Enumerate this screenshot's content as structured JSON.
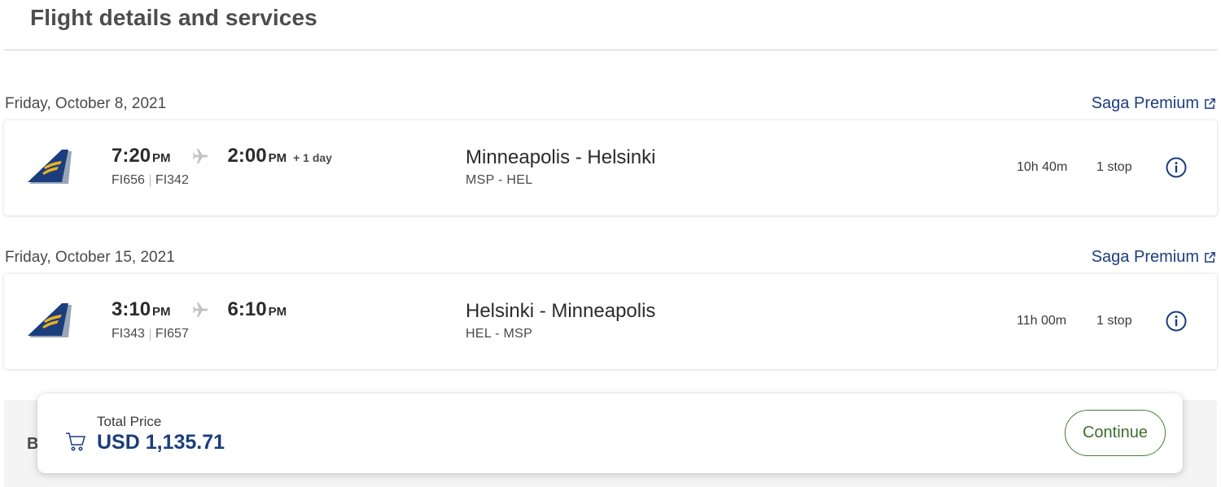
{
  "page": {
    "title": "Flight details and services"
  },
  "colors": {
    "brand_navy": "#1b3d7d",
    "continue_green": "#3f6e2b",
    "logo_gold": "#e9b123"
  },
  "flights": [
    {
      "date": "Friday, October 8, 2021",
      "fare_link": "Saga Premium",
      "depart_time": "7:20",
      "depart_ampm": "PM",
      "arrive_time": "2:00",
      "arrive_ampm": "PM",
      "plus_day": "+ 1 day",
      "flight_1": "FI656",
      "flight_2": "FI342",
      "route_name": "Minneapolis - Helsinki",
      "route_codes": "MSP - HEL",
      "duration": "10h 40m",
      "stops": "1 stop"
    },
    {
      "date": "Friday, October 15, 2021",
      "fare_link": "Saga Premium",
      "depart_time": "3:10",
      "depart_ampm": "PM",
      "arrive_time": "6:10",
      "arrive_ampm": "PM",
      "plus_day": "",
      "flight_1": "FI343",
      "flight_2": "FI657",
      "route_name": "Helsinki - Minneapolis",
      "route_codes": "HEL - MSP",
      "duration": "11h 00m",
      "stops": "1 stop"
    }
  ],
  "bottom_panel": {
    "heading_partial": "B"
  },
  "price_bar": {
    "label": "Total Price",
    "value": "USD 1,135.71",
    "continue_label": "Continue"
  }
}
